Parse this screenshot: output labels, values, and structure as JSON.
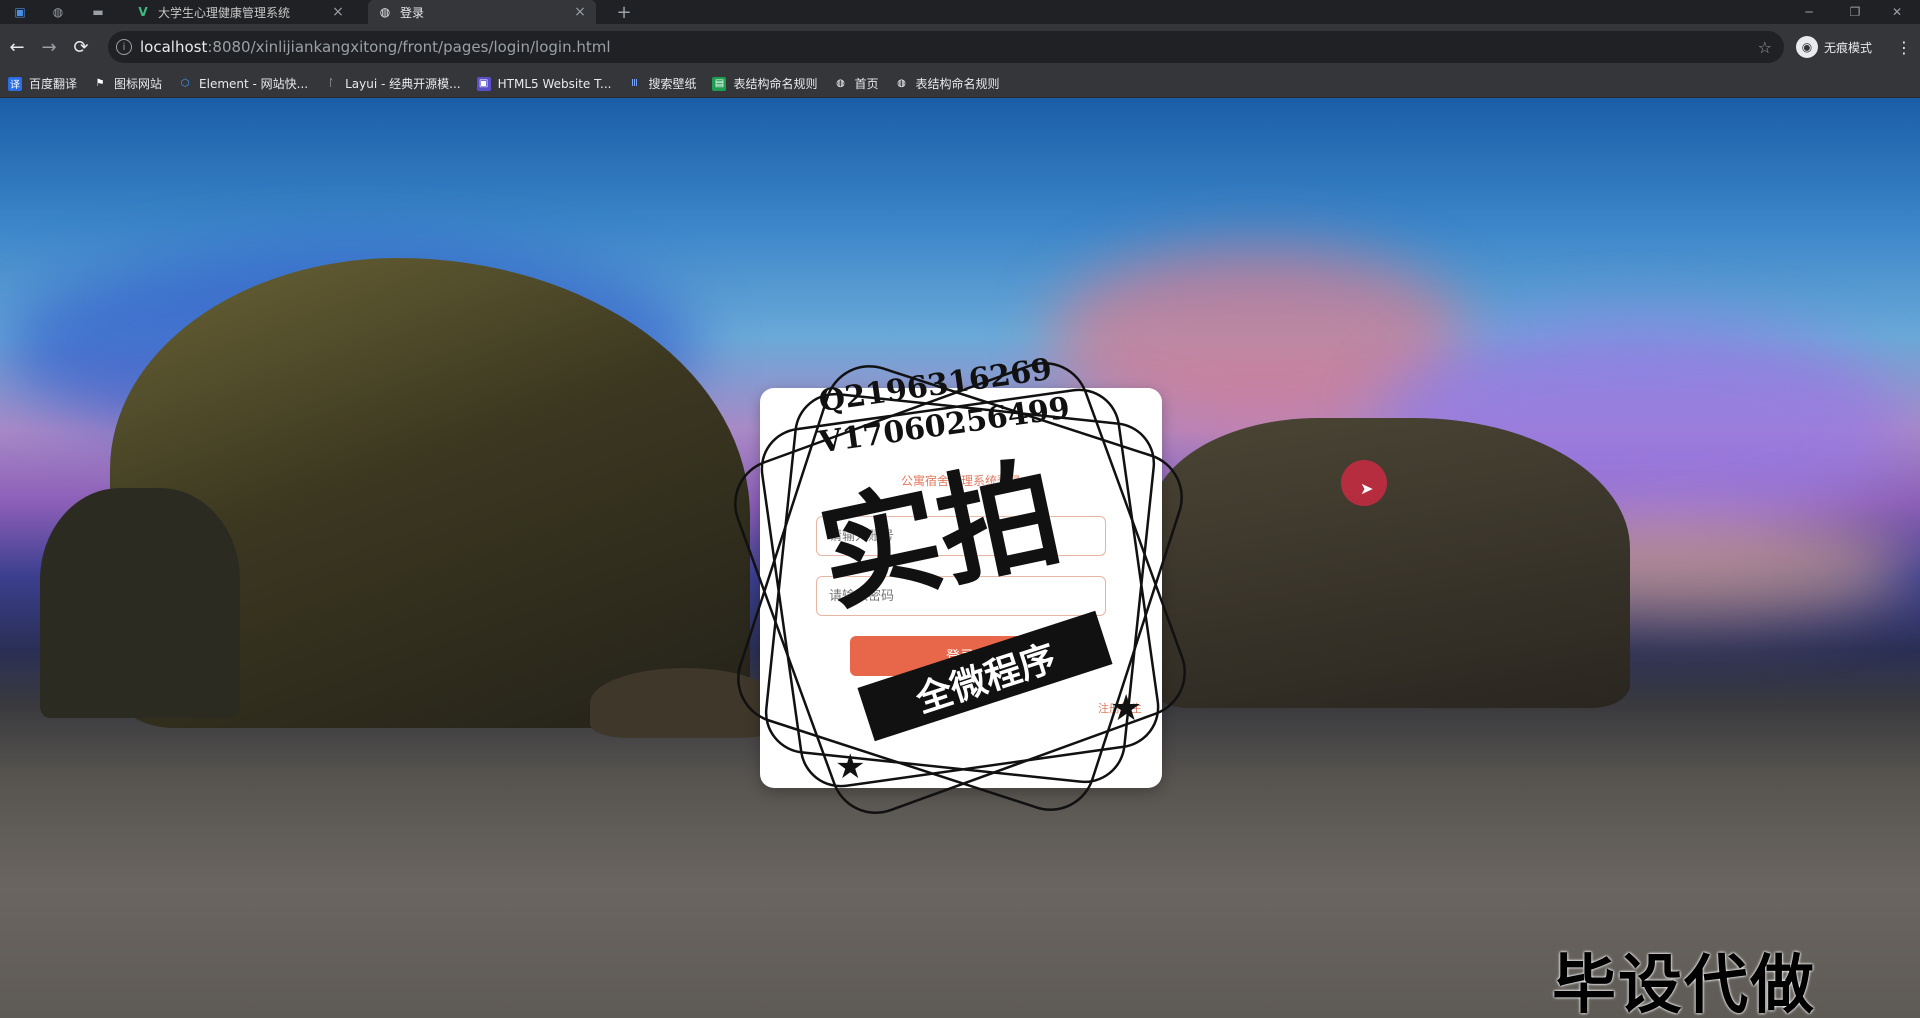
{
  "tabs": [
    {
      "title": "大学生心理健康管理系统",
      "close": "×"
    },
    {
      "title": "登录",
      "close": "×"
    }
  ],
  "new_tab": "+",
  "window_controls": {
    "minimize": "─",
    "restore": "❐",
    "close": "✕"
  },
  "toolbar": {
    "back": "←",
    "forward": "→",
    "reload": "⟳",
    "info": "i",
    "url_host": "localhost",
    "url_path": ":8080/xinlijiankangxitong/front/pages/login/login.html",
    "star": "☆",
    "incognito_label": "无痕模式",
    "menu": "⋮"
  },
  "bookmarks": [
    {
      "label": "百度翻译",
      "icon": "translate-icon",
      "color": "#2b6de5"
    },
    {
      "label": "图标网站",
      "icon": "flag-icon",
      "color": "#35363a"
    },
    {
      "label": "Element - 网站快...",
      "icon": "element-icon",
      "color": "#409eff"
    },
    {
      "label": "Layui - 经典开源模...",
      "icon": "layui-icon",
      "color": "#35363a"
    },
    {
      "label": "HTML5 Website T...",
      "icon": "html5-icon",
      "color": "#5b4fc8"
    },
    {
      "label": "搜索壁纸",
      "icon": "wallpaper-icon",
      "color": "#3f6fd8"
    },
    {
      "label": "表结构命名规则",
      "icon": "sheet-icon",
      "color": "#1e9e50"
    },
    {
      "label": "首页",
      "icon": "globe-icon",
      "color": "#35363a"
    },
    {
      "label": "表结构命名规则",
      "icon": "globe-icon",
      "color": "#35363a"
    }
  ],
  "login": {
    "title": "公寓宿舍管理系统登录",
    "username_placeholder": "请输入账号",
    "password_placeholder": "请输入密码",
    "login_button": "登录",
    "register_link": "注册学生"
  },
  "watermark": {
    "qq": "Q2196316269",
    "vx": "V17060256499",
    "big": "实拍",
    "ribbon": "全微程序",
    "corner": "毕设代做"
  }
}
